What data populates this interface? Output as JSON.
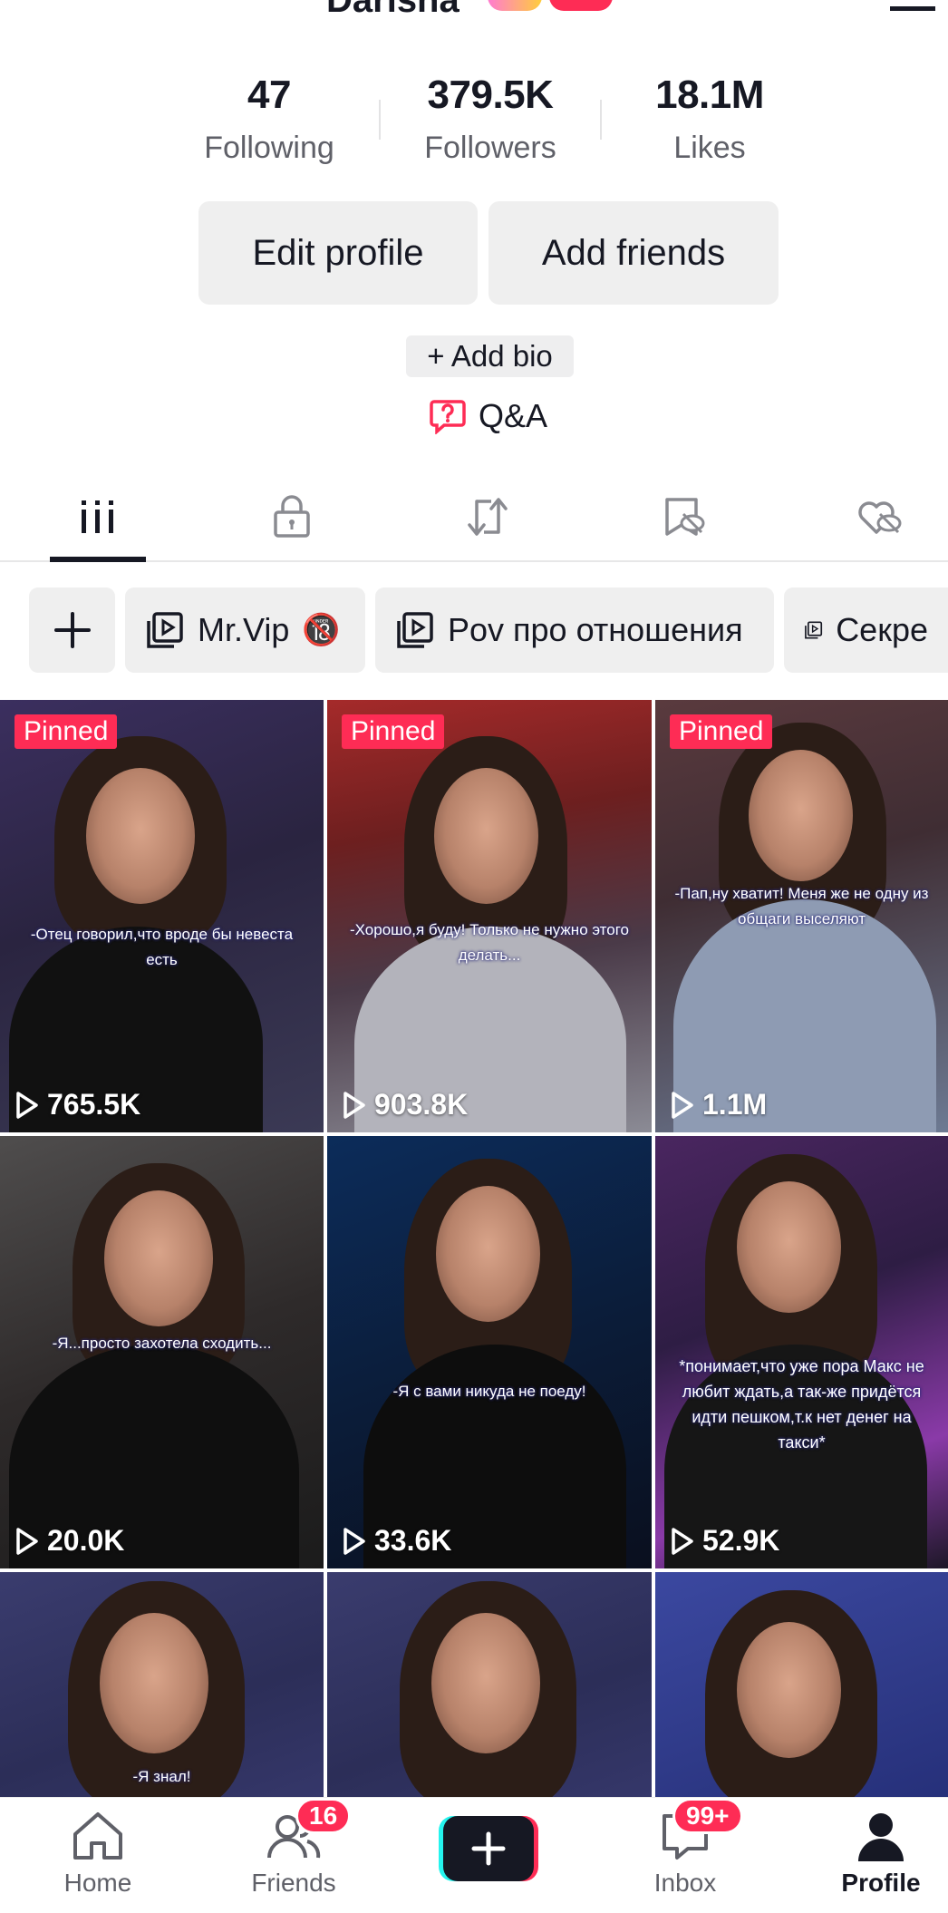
{
  "header": {
    "username": "Darisha",
    "menu_icon": "hamburger-icon"
  },
  "stats": {
    "following": {
      "value": "47",
      "label": "Following"
    },
    "followers": {
      "value": "379.5K",
      "label": "Followers"
    },
    "likes": {
      "value": "18.1M",
      "label": "Likes"
    }
  },
  "actions": {
    "edit_profile": "Edit profile",
    "add_friends": "Add friends",
    "add_bio": "+ Add bio",
    "qa": "Q&A"
  },
  "tabs": [
    {
      "icon": "videos-grid-icon",
      "active": true
    },
    {
      "icon": "lock-icon",
      "active": false
    },
    {
      "icon": "repost-icon",
      "active": false
    },
    {
      "icon": "favorites-hidden-icon",
      "active": false
    },
    {
      "icon": "liked-hidden-icon",
      "active": false
    }
  ],
  "playlists": {
    "add_icon": "plus-icon",
    "items": [
      {
        "label": "Mr.Vip",
        "emoji": "🔞"
      },
      {
        "label": "Pov про отношения",
        "emoji": ""
      },
      {
        "label": "Секре",
        "emoji": ""
      }
    ]
  },
  "videos": [
    {
      "pinned": "Pinned",
      "views": "765.5K",
      "caption": "-Отец говорил,что вроде бы невеста есть"
    },
    {
      "pinned": "Pinned",
      "views": "903.8K",
      "caption": "-Хорошо,я буду! Только не нужно этого делать..."
    },
    {
      "pinned": "Pinned",
      "views": "1.1M",
      "caption": "-Пап,ну хватит! Меня же не одну из общаги выселяют"
    },
    {
      "pinned": "",
      "views": "20.0K",
      "caption": "-Я...просто захотела сходить..."
    },
    {
      "pinned": "",
      "views": "33.6K",
      "caption": "-Я с вами никуда не поеду!"
    },
    {
      "pinned": "",
      "views": "52.9K",
      "caption": "*понимает,что уже пора Макс не любит ждать,а так-же придётся идти пешком,т.к нет денег на такси*"
    },
    {
      "pinned": "",
      "views": "",
      "caption": "-Я знал!"
    },
    {
      "pinned": "",
      "views": "",
      "caption": ""
    },
    {
      "pinned": "",
      "views": "",
      "caption": ""
    }
  ],
  "nav": {
    "home": "Home",
    "friends": "Friends",
    "friends_badge": "16",
    "inbox": "Inbox",
    "inbox_badge": "99+",
    "profile": "Profile"
  },
  "colors": {
    "accent": "#fe2c55",
    "cyan": "#25f4ee",
    "text": "#161823",
    "muted": "#5f6068",
    "button_bg": "#efefef"
  }
}
